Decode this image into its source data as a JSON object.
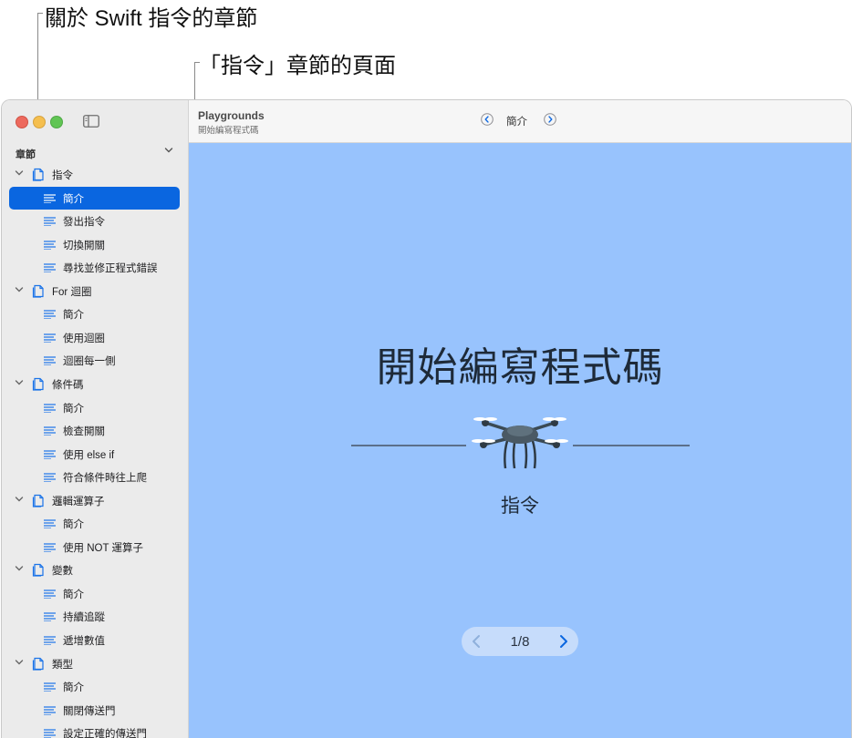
{
  "callouts": {
    "chapters": "關於 Swift 指令的章節",
    "pages": "「指令」章節的頁面"
  },
  "sidebar": {
    "header": "章節",
    "rows": [
      {
        "type": "chapter",
        "label": "指令"
      },
      {
        "type": "page",
        "label": "簡介",
        "selected": true
      },
      {
        "type": "page",
        "label": "發出指令"
      },
      {
        "type": "page",
        "label": "切換開關"
      },
      {
        "type": "page",
        "label": "尋找並修正程式錯誤"
      },
      {
        "type": "chapter",
        "label": "For 迴圈"
      },
      {
        "type": "page",
        "label": "簡介"
      },
      {
        "type": "page",
        "label": "使用迴圈"
      },
      {
        "type": "page",
        "label": "迴圈每一側"
      },
      {
        "type": "chapter",
        "label": "條件碼"
      },
      {
        "type": "page",
        "label": "簡介"
      },
      {
        "type": "page",
        "label": "檢查開關"
      },
      {
        "type": "page",
        "label": "使用 else if"
      },
      {
        "type": "page",
        "label": "符合條件時往上爬"
      },
      {
        "type": "chapter",
        "label": "邏輯運算子"
      },
      {
        "type": "page",
        "label": "簡介"
      },
      {
        "type": "page",
        "label": "使用 NOT 運算子"
      },
      {
        "type": "chapter",
        "label": "變數"
      },
      {
        "type": "page",
        "label": "簡介"
      },
      {
        "type": "page",
        "label": "持續追蹤"
      },
      {
        "type": "page",
        "label": "遞增數值"
      },
      {
        "type": "chapter",
        "label": "類型"
      },
      {
        "type": "page",
        "label": "簡介"
      },
      {
        "type": "page",
        "label": "關閉傳送門"
      },
      {
        "type": "page",
        "label": "設定正確的傳送門"
      }
    ]
  },
  "toolbar": {
    "title": "Playgrounds",
    "subtitle": "開始編寫程式碼",
    "page": "簡介"
  },
  "content": {
    "title": "開始編寫程式碼",
    "caption": "指令",
    "pager": "1/8"
  },
  "colors": {
    "accent": "#0a66e0",
    "content_bg": "#98c3fd",
    "sidebar_bg": "#ebebeb"
  },
  "icons": {
    "chapter": "chapter-page-icon",
    "page": "text-lines-icon",
    "drone": "drone-icon"
  }
}
